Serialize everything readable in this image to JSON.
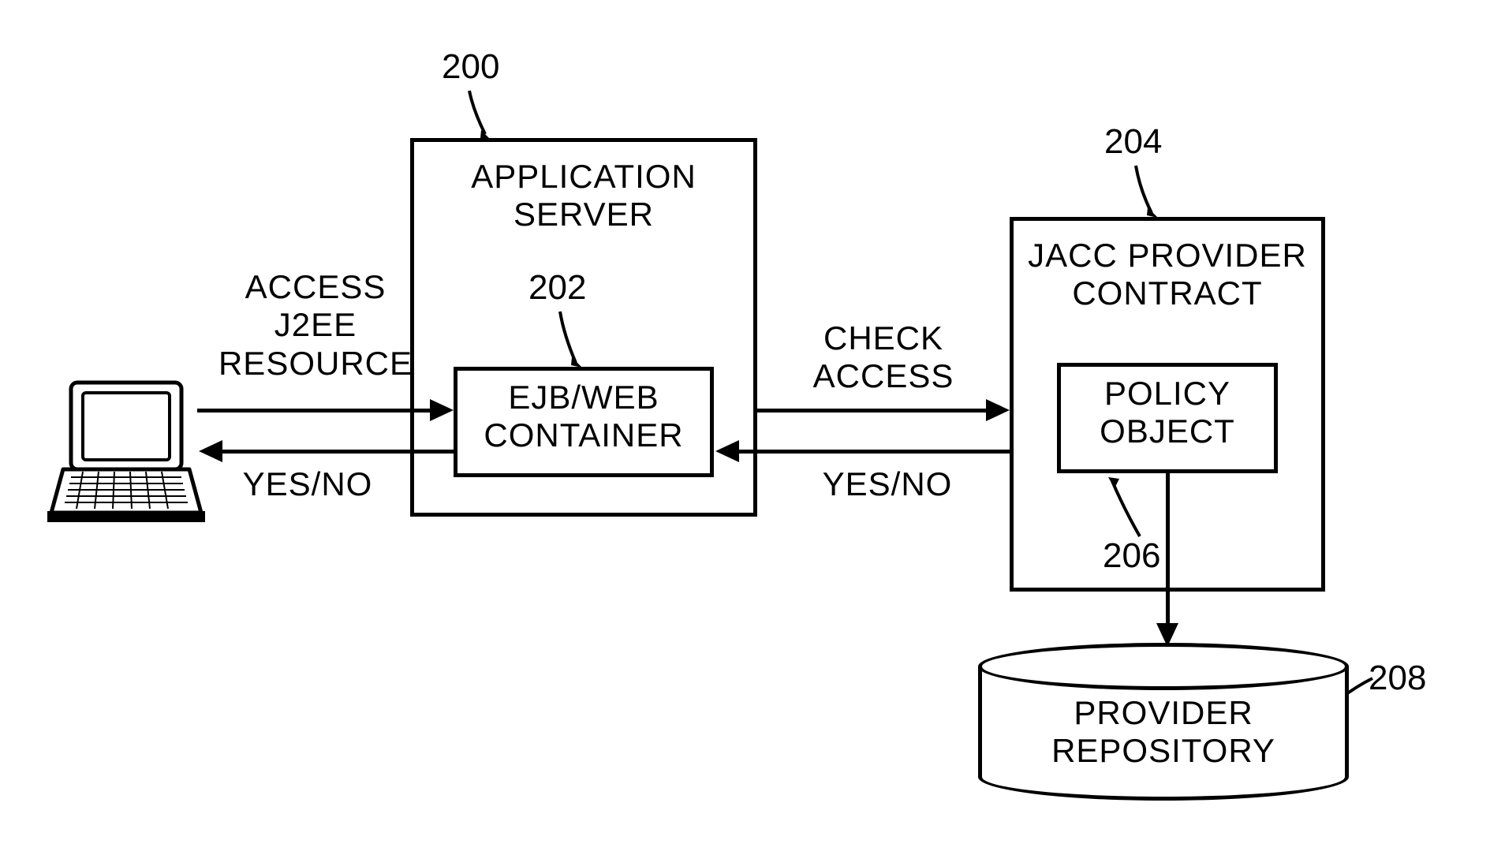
{
  "refs": {
    "app_server": "200",
    "container": "202",
    "provider": "204",
    "policy": "206",
    "repository": "208"
  },
  "boxes": {
    "app_server": {
      "line1": "APPLICATION",
      "line2": "SERVER"
    },
    "container": {
      "line1": "EJB/WEB",
      "line2": "CONTAINER"
    },
    "provider": {
      "line1": "JACC PROVIDER",
      "line2": "CONTRACT"
    },
    "policy": {
      "line1": "POLICY",
      "line2": "OBJECT"
    }
  },
  "arrows": {
    "access": {
      "line1": "ACCESS",
      "line2": "J2EE",
      "line3": "RESOURCE"
    },
    "yesno1": "YES/NO",
    "check": {
      "line1": "CHECK",
      "line2": "ACCESS"
    },
    "yesno2": "YES/NO"
  },
  "cylinder": {
    "line1": "PROVIDER",
    "line2": "REPOSITORY"
  }
}
